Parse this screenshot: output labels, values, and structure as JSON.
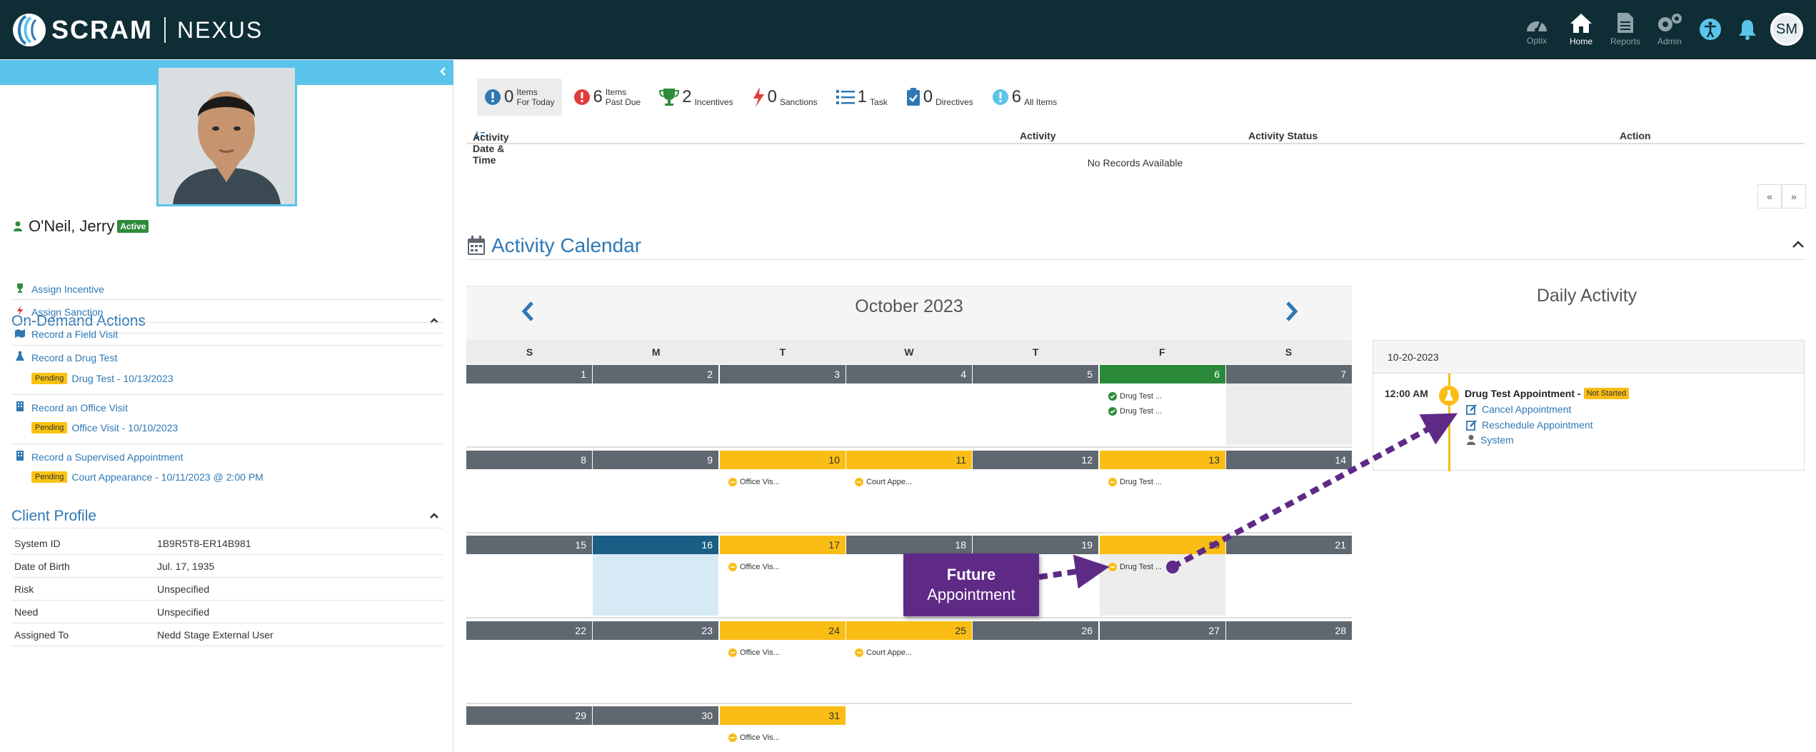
{
  "header": {
    "brand": "SCRAM",
    "product": "NEXUS",
    "nav": [
      {
        "label": "Optix",
        "icon": "gauge-icon"
      },
      {
        "label": "Home",
        "icon": "home-icon"
      },
      {
        "label": "Reports",
        "icon": "document-icon"
      },
      {
        "label": "Admin",
        "icon": "gears-icon"
      }
    ],
    "user_initials": "SM"
  },
  "client": {
    "name": "O'Neil, Jerry",
    "status": "Active"
  },
  "on_demand": {
    "title": "On-Demand Actions",
    "actions": [
      {
        "label": "Assign Incentive",
        "icon": "trophy-icon"
      },
      {
        "label": "Assign Sanction",
        "icon": "bolt-icon"
      },
      {
        "label": "Record a Field Visit",
        "icon": "map-icon"
      },
      {
        "label": "Record a Drug Test",
        "icon": "flask-icon"
      },
      {
        "label": "Record an Office Visit",
        "icon": "building-icon"
      },
      {
        "label": "Record a Supervised Appointment",
        "icon": "building-icon"
      }
    ],
    "pending": [
      {
        "badge": "Pending",
        "label": "Drug Test - 10/13/2023"
      },
      {
        "badge": "Pending",
        "label": "Office Visit - 10/10/2023"
      },
      {
        "badge": "Pending",
        "label": "Court Appearance - 10/11/2023 @ 2:00 PM"
      }
    ]
  },
  "profile": {
    "title": "Client Profile",
    "rows": [
      {
        "k": "System ID",
        "v": "1B9R5T8-ER14B981"
      },
      {
        "k": "Date of Birth",
        "v": "Jul. 17, 1935"
      },
      {
        "k": "Risk",
        "v": "Unspecified"
      },
      {
        "k": "Need",
        "v": "Unspecified"
      },
      {
        "k": "Assigned To",
        "v": "Nedd Stage External User"
      }
    ]
  },
  "summary": [
    {
      "num": "0",
      "l1": "Items",
      "l2": "For Today",
      "icon": "exclaim-blue-icon"
    },
    {
      "num": "6",
      "l1": "Items",
      "l2": "Past Due",
      "icon": "exclaim-red-icon"
    },
    {
      "num": "2",
      "l1": "",
      "l2": "Incentives",
      "icon": "trophy-icon"
    },
    {
      "num": "0",
      "l1": "",
      "l2": "Sanctions",
      "icon": "bolt-icon"
    },
    {
      "num": "1",
      "l1": "",
      "l2": "Task",
      "icon": "list-icon"
    },
    {
      "num": "0",
      "l1": "",
      "l2": "Directives",
      "icon": "clipboard-icon"
    },
    {
      "num": "6",
      "l1": "",
      "l2": "All Items",
      "icon": "exclaim-light-icon"
    }
  ],
  "table": {
    "cols": [
      "Activity Date & Time",
      "Activity",
      "Activity Status",
      "Action"
    ],
    "empty": "No Records Available",
    "pager": [
      "«",
      "»"
    ]
  },
  "calendar": {
    "section_title": "Activity Calendar",
    "month": "October 2023",
    "dow": [
      "S",
      "M",
      "T",
      "W",
      "T",
      "F",
      "S"
    ],
    "days": [
      {
        "d": "1"
      },
      {
        "d": "2"
      },
      {
        "d": "3"
      },
      {
        "d": "4"
      },
      {
        "d": "5"
      },
      {
        "d": "6",
        "style": "green",
        "events": [
          {
            "t": "Drug Test ...",
            "k": "ok"
          },
          {
            "t": "Drug Test ...",
            "k": "ok"
          }
        ]
      },
      {
        "d": "7",
        "style": "gray"
      },
      {
        "d": "8"
      },
      {
        "d": "9"
      },
      {
        "d": "10",
        "style": "yellow",
        "events": [
          {
            "t": "Office Vis...",
            "k": "pend"
          }
        ]
      },
      {
        "d": "11",
        "style": "yellow",
        "events": [
          {
            "t": "Court Appe...",
            "k": "pend"
          }
        ]
      },
      {
        "d": "12"
      },
      {
        "d": "13",
        "style": "yellow",
        "events": [
          {
            "t": "Drug Test ...",
            "k": "pend"
          }
        ]
      },
      {
        "d": "14"
      },
      {
        "d": "15"
      },
      {
        "d": "16",
        "style": "blue"
      },
      {
        "d": "17",
        "style": "yellow",
        "events": [
          {
            "t": "Office Vis...",
            "k": "pend"
          }
        ]
      },
      {
        "d": "18"
      },
      {
        "d": "19"
      },
      {
        "d": "20",
        "style": "yellow gray",
        "events": [
          {
            "t": "Drug Test ...",
            "k": "pend"
          }
        ]
      },
      {
        "d": "21"
      },
      {
        "d": "22"
      },
      {
        "d": "23"
      },
      {
        "d": "24",
        "style": "yellow",
        "events": [
          {
            "t": "Office Vis...",
            "k": "pend"
          }
        ]
      },
      {
        "d": "25",
        "style": "yellow",
        "events": [
          {
            "t": "Court Appe...",
            "k": "pend"
          }
        ]
      },
      {
        "d": "26"
      },
      {
        "d": "27"
      },
      {
        "d": "28"
      },
      {
        "d": "29"
      },
      {
        "d": "30"
      },
      {
        "d": "31",
        "style": "yellow",
        "events": [
          {
            "t": "Office Vis...",
            "k": "pend"
          }
        ]
      }
    ]
  },
  "daily": {
    "title": "Daily Activity",
    "date": "10-20-2023",
    "time": "12:00 AM",
    "appt": "Drug Test Appointment",
    "status": "Not Started",
    "links": [
      {
        "label": "Cancel Appointment",
        "icon": "edit-icon"
      },
      {
        "label": "Reschedule Appointment",
        "icon": "edit-icon"
      },
      {
        "label": "System",
        "icon": "user-icon"
      }
    ]
  },
  "callout": {
    "line1": "Future",
    "line2": "Appointment"
  }
}
